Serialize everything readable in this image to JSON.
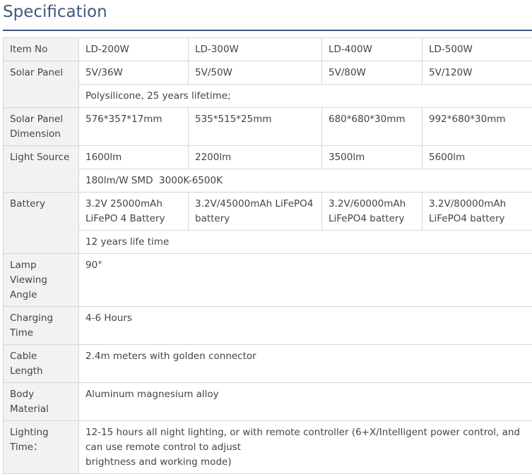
{
  "section": {
    "title": "Specification"
  },
  "table": {
    "item_no": {
      "label": "Item No",
      "values": [
        "LD-200W",
        "LD-300W",
        "LD-400W",
        "LD-500W"
      ]
    },
    "solar_panel": {
      "label": "Solar Panel",
      "values": [
        "5V/36W",
        "5V/50W",
        "5V/80W",
        "5V/120W"
      ],
      "note": "Polysilicone, 25 years lifetime;"
    },
    "solar_panel_dimension": {
      "label": "Solar Panel Dimension",
      "values": [
        "576*357*17mm",
        "535*515*25mm",
        "680*680*30mm",
        "992*680*30mm"
      ]
    },
    "light_source": {
      "label": "Light Source",
      "values": [
        "1600lm",
        "2200lm",
        "3500lm",
        "5600lm"
      ],
      "note": "180lm/W SMD  3000K-6500K"
    },
    "battery": {
      "label": "Battery",
      "values": [
        "3.2V 25000mAh LiFePO 4 Battery",
        "3.2V/45000mAh LiFePO4 battery",
        "3.2V/60000mAh LiFePO4 battery",
        "3.2V/80000mAh LiFePO4 battery"
      ],
      "note": "12 years life time"
    },
    "lamp_viewing_angle": {
      "label": "Lamp Viewing Angle",
      "value": "90°"
    },
    "charging_time": {
      "label": "Charging Time",
      "value": "4-6 Hours"
    },
    "cable_length": {
      "label": "Cable Length",
      "value": "2.4m meters with golden connector"
    },
    "body_material": {
      "label": "Body Material",
      "value": "Aluminum magnesium alloy"
    },
    "lighting_time": {
      "label": "Lighting Time：",
      "value_line1": "12-15 hours all night lighting, or with remote controller (6+X/Intelligent power control, and can use remote control to adjust",
      "value_line2": "brightness and working mode)"
    }
  },
  "colors": {
    "heading": "#3d5a80",
    "label_bg": "#f2f2f2",
    "border": "#d6d6d6",
    "text": "#444444"
  }
}
